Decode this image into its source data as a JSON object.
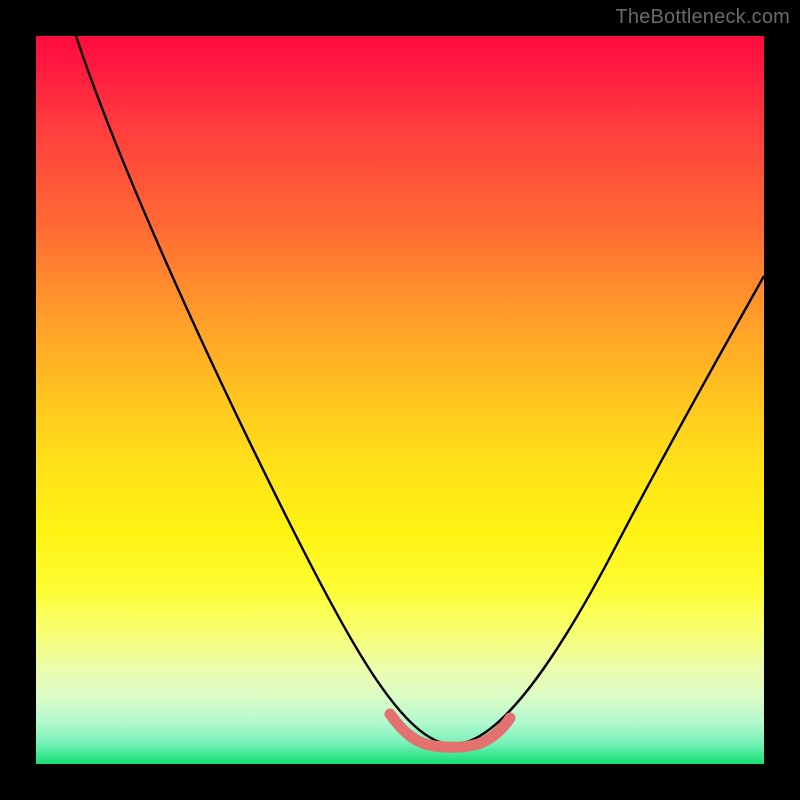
{
  "watermark": "TheBottleneck.com",
  "colors": {
    "background": "#000000",
    "gradient_top": "#ff0b3e",
    "gradient_mid": "#ffe418",
    "gradient_bottom": "#17dc73",
    "curve": "#000000",
    "highlight": "#e2716f"
  },
  "chart_data": {
    "type": "line",
    "title": "",
    "xlabel": "",
    "ylabel": "",
    "xlim": [
      0,
      100
    ],
    "ylim": [
      0,
      100
    ],
    "grid": false,
    "series": [
      {
        "name": "main-curve",
        "x": [
          0,
          10,
          20,
          30,
          40,
          48,
          52,
          56,
          60,
          62,
          70,
          80,
          90,
          100
        ],
        "values": [
          100,
          85,
          67,
          49,
          31,
          15,
          5,
          3,
          3,
          5,
          14,
          28,
          42,
          55
        ]
      },
      {
        "name": "bottom-highlight",
        "x": [
          48,
          52,
          56,
          60,
          62
        ],
        "values": [
          15,
          5,
          3,
          3,
          5
        ]
      }
    ],
    "annotations": []
  }
}
